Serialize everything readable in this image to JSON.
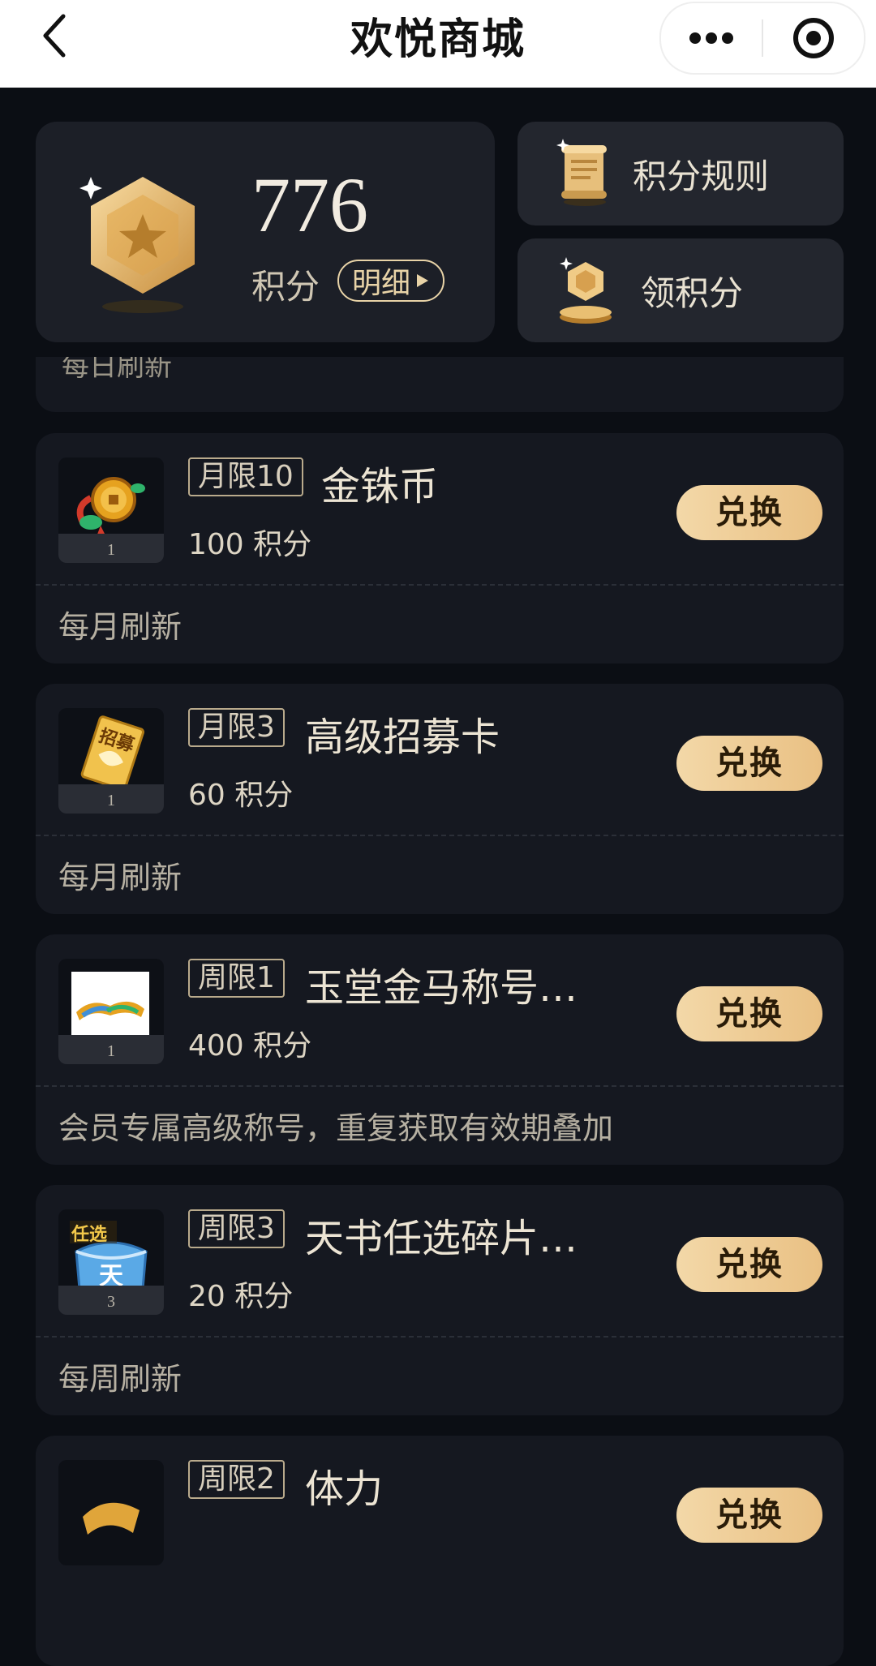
{
  "nav": {
    "title": "欢悦商城"
  },
  "header": {
    "points_value": "776",
    "points_label": "积分",
    "detail_label": "明细",
    "rules_label": "积分规则",
    "earn_label": "领积分"
  },
  "partial_top": {
    "refresh": "每日刷新"
  },
  "items": [
    {
      "tag": "月限10",
      "name": "金铢币",
      "cost": "100 积分",
      "count": "1",
      "button": "兑换",
      "refresh": "每月刷新",
      "icon": "gold-coin-icon"
    },
    {
      "tag": "月限3",
      "name": "高级招募卡",
      "cost": "60 积分",
      "count": "1",
      "button": "兑换",
      "refresh": "每月刷新",
      "icon": "recruit-card-icon",
      "icon_text": "招募"
    },
    {
      "tag": "周限1",
      "name": "玉堂金马称号…",
      "cost": "400 积分",
      "count": "1",
      "button": "兑换",
      "refresh": "会员专属高级称号，重复获取有效期叠加",
      "icon": "title-badge-icon"
    },
    {
      "tag": "周限3",
      "name": "天书任选碎片…",
      "cost": "20 积分",
      "count": "3",
      "button": "兑换",
      "refresh": "每周刷新",
      "icon": "tianshu-chest-icon",
      "icon_text": "任选",
      "icon_text2": "天"
    },
    {
      "tag": "周限2",
      "name": "体力",
      "button": "兑换",
      "icon": "stamina-icon"
    }
  ],
  "colors": {
    "background": "#0b0e14",
    "card": "#151820",
    "accent": "#e9c083"
  }
}
